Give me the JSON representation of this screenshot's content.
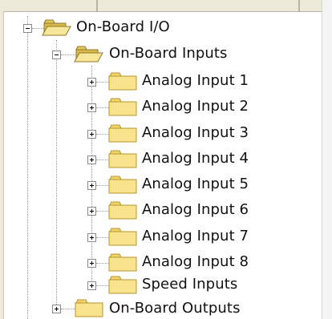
{
  "tree": {
    "root": {
      "label": "On-Board I/O",
      "expanded": true
    },
    "inputs": {
      "label": "On-Board Inputs",
      "expanded": true
    },
    "items": [
      {
        "label": "Analog Input 1"
      },
      {
        "label": "Analog Input 2"
      },
      {
        "label": "Analog Input 3"
      },
      {
        "label": "Analog Input 4"
      },
      {
        "label": "Analog Input 5"
      },
      {
        "label": "Analog Input 6"
      },
      {
        "label": "Analog Input 7"
      },
      {
        "label": "Analog Input 8"
      },
      {
        "label": "Speed Inputs"
      }
    ],
    "outputs": {
      "label": "On-Board Outputs",
      "expanded": false
    }
  }
}
